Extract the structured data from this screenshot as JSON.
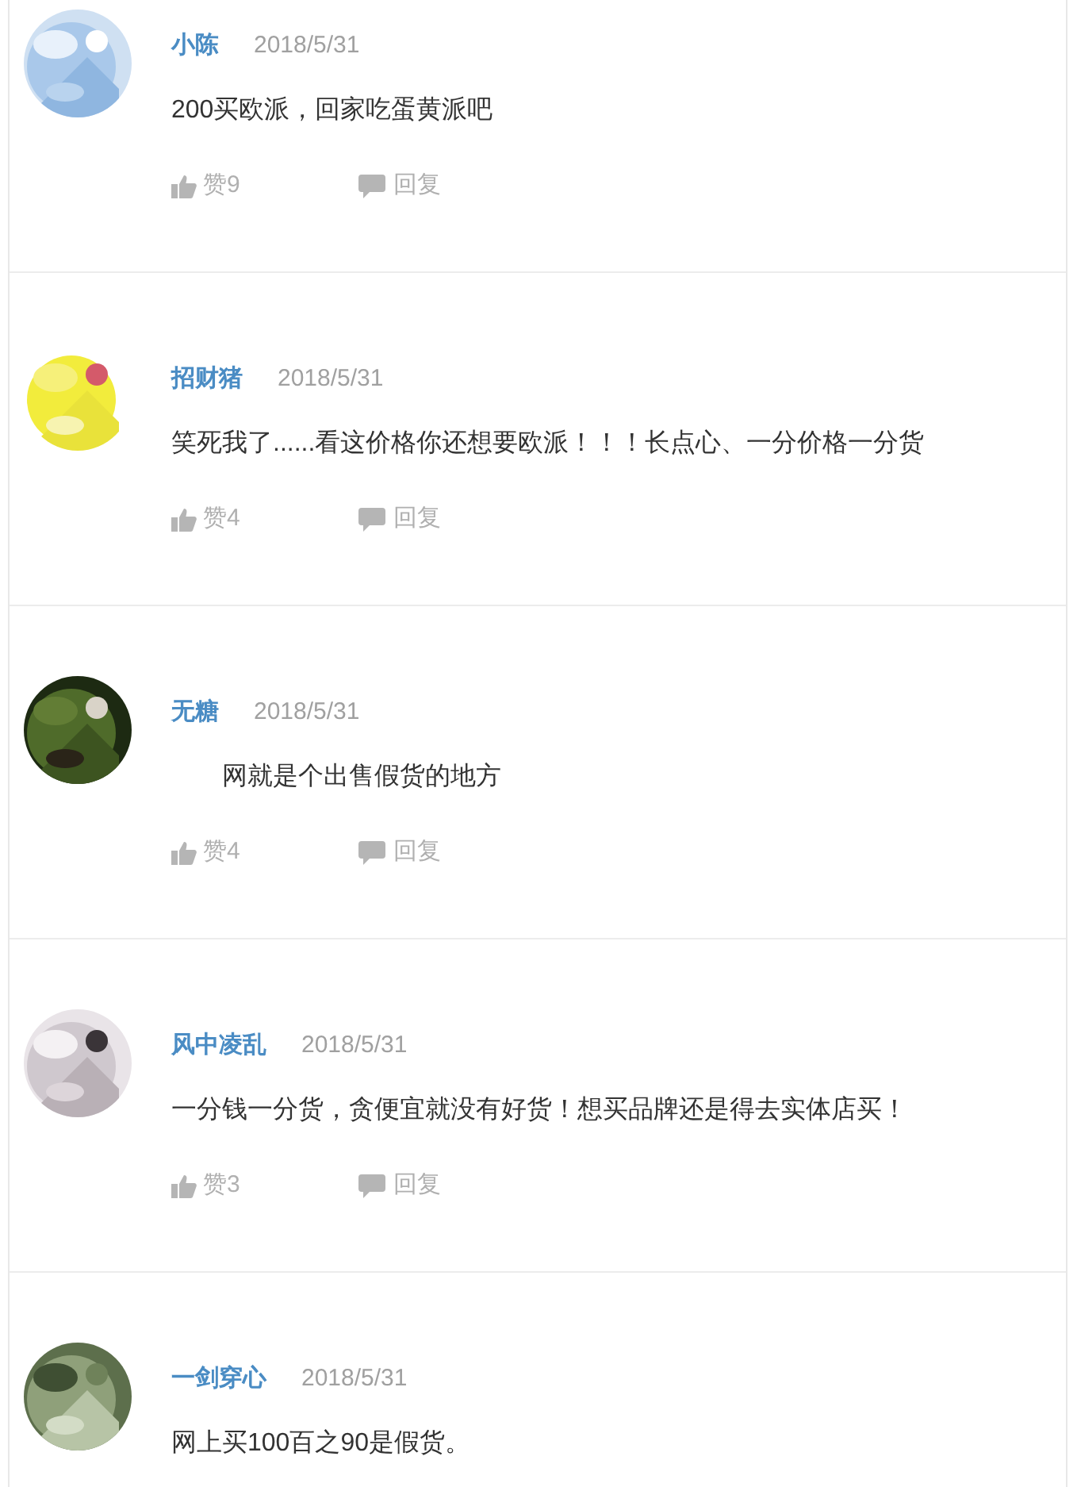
{
  "comments": [
    {
      "name": "小陈",
      "date": "2018/5/31",
      "text": "200买欧派，回家吃蛋黄派吧",
      "likes": "赞9",
      "reply": "回复"
    },
    {
      "name": "招财猪",
      "date": "2018/5/31",
      "text": "笑死我了......看这价格你还想要欧派！！！长点心、一分价格一分货",
      "likes": "赞4",
      "reply": "回复"
    },
    {
      "name": "无糖",
      "date": "2018/5/31",
      "text": "　　网就是个出售假货的地方",
      "likes": "赞4",
      "reply": "回复"
    },
    {
      "name": "风中凌乱",
      "date": "2018/5/31",
      "text": "一分钱一分货，贪便宜就没有好货！想买品牌还是得去实体店买！",
      "likes": "赞3",
      "reply": "回复"
    },
    {
      "name": "一剑穿心",
      "date": "2018/5/31",
      "text": "网上买100百之90是假货。"
    }
  ]
}
